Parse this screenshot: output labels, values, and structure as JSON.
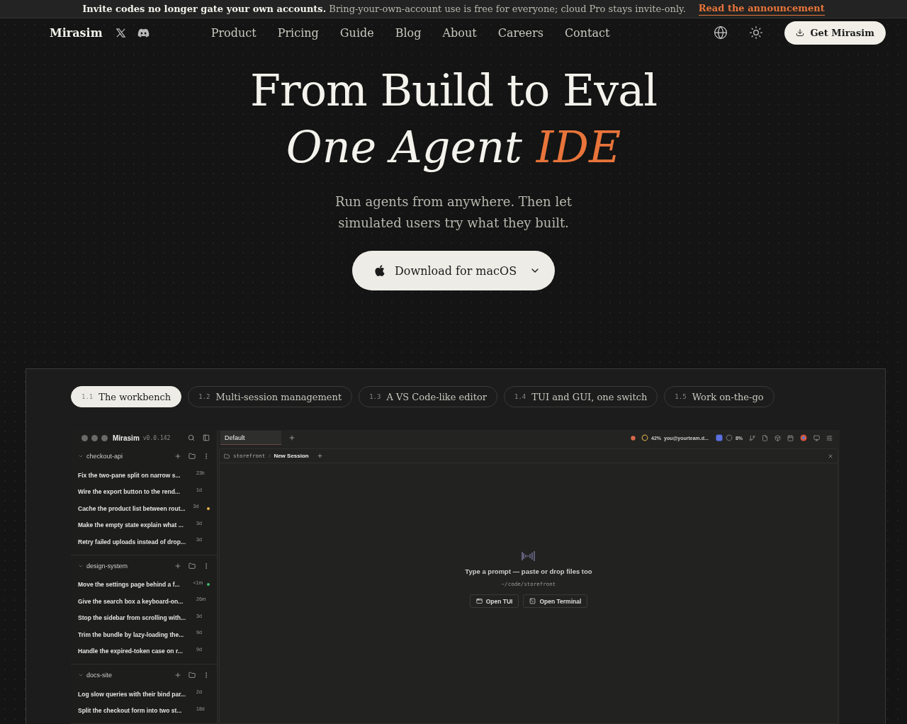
{
  "banner": {
    "message": "**Invite codes no longer gate your own accounts.** Bring-your-own-account use is free for everyone; cloud Pro stays invite-only.",
    "link": "Read the announcement"
  },
  "nav": {
    "brand": "Mirasim",
    "links": [
      "Product",
      "Pricing",
      "Guide",
      "Blog",
      "About",
      "Careers",
      "Contact"
    ],
    "cta": "Get Mirasim"
  },
  "hero": {
    "title": "From Build to Eval",
    "title_line2": [
      {
        "text": "One Agent ",
        "accent": false
      },
      {
        "text": "IDE",
        "accent": true
      }
    ],
    "subtitle": "Run agents from anywhere. Then let simulated users try what they built.",
    "download": "Download for macOS"
  },
  "feature_tabs": [
    {
      "number": "1.1",
      "label": "The workbench",
      "selected": true
    },
    {
      "number": "1.2",
      "label": "Multi-session management",
      "selected": false
    },
    {
      "number": "1.3",
      "label": "A VS Code-like editor",
      "selected": false
    },
    {
      "number": "1.4",
      "label": "TUI and GUI, one switch",
      "selected": false
    },
    {
      "number": "1.5",
      "label": "Work on-the-go",
      "selected": false
    }
  ],
  "app": {
    "brand": "Mirasim",
    "version": "v0.0.142",
    "tabs": [
      {
        "label": "Default",
        "selected": true
      }
    ],
    "status": {
      "cpu": "42%",
      "account": "you@yourteam.d...",
      "usage": "8%"
    },
    "breadcrumb": {
      "folder": "storefront",
      "separator": "/",
      "session": "New Session"
    },
    "projects": [
      {
        "name": "checkout-api",
        "expanded": true,
        "sessions": [
          {
            "title": "Fix the two-pane split on narrow s...",
            "time": "23h"
          },
          {
            "title": "Wire the export button to the rend...",
            "time": "1d"
          },
          {
            "title": "Cache the product list between rout...",
            "time": "3d",
            "color": "#e8b04a"
          },
          {
            "title": "Make the empty state explain what ...",
            "time": "3d"
          },
          {
            "title": "Retry failed uploads instead of drop...",
            "time": "3d"
          }
        ]
      },
      {
        "name": "design-system",
        "expanded": true,
        "sessions": [
          {
            "title": "Move the settings page behind a f...",
            "time": "<1m",
            "color": "#3fb96b"
          },
          {
            "title": "Give the search box a keyboard-on...",
            "time": "26m"
          },
          {
            "title": "Stop the sidebar from scrolling with...",
            "time": "3d"
          },
          {
            "title": "Trim the bundle by lazy-loading the...",
            "time": "9d"
          },
          {
            "title": "Handle the expired-token case on r...",
            "time": "9d"
          }
        ]
      },
      {
        "name": "docs-site",
        "expanded": true,
        "sessions": [
          {
            "title": "Log slow queries with their bind par...",
            "time": "2d"
          },
          {
            "title": "Split the checkout form into two st...",
            "time": "18d"
          }
        ]
      }
    ],
    "empty": {
      "prompt": "Type a prompt — paste or drop files too",
      "path": "~/code/storefront",
      "buttons": [
        "Open TUI",
        "Open Terminal"
      ]
    }
  }
}
